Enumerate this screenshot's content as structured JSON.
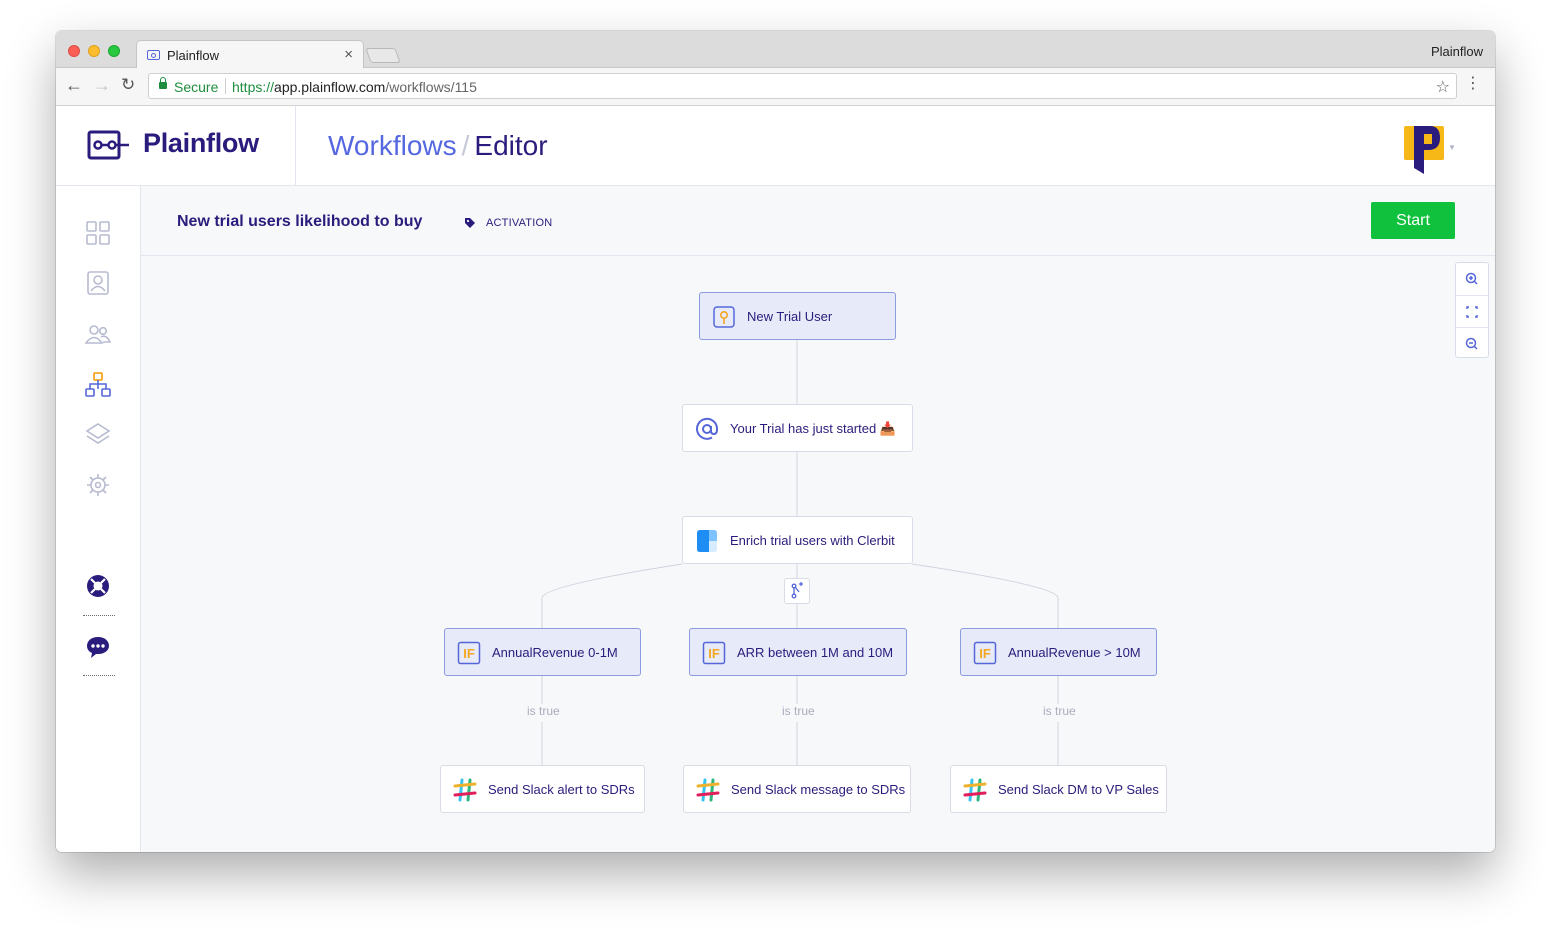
{
  "browser": {
    "tab_title": "Plainflow",
    "tab_close": "×",
    "profile_name": "Plainflow",
    "back": "←",
    "forward": "→",
    "reload": "↻",
    "secure_label": "Secure",
    "url_scheme": "https://",
    "url_host": "app.plainflow.com",
    "url_path": "/workflows/115",
    "star": "☆",
    "menu": "⋮"
  },
  "app": {
    "brand_name": "Plainflow",
    "breadcrumb": {
      "parent": "Workflows",
      "separator": "/",
      "current": "Editor"
    }
  },
  "sidebar": {
    "items": [
      {
        "name": "dashboard-icon"
      },
      {
        "name": "user-profile-icon"
      },
      {
        "name": "people-icon"
      },
      {
        "name": "workflows-icon",
        "active": true
      },
      {
        "name": "layers-icon"
      },
      {
        "name": "settings-gear-icon"
      },
      {
        "name": "help-lifebuoy-icon"
      },
      {
        "name": "chat-icon"
      }
    ]
  },
  "workflow": {
    "title": "New trial users likelihood to buy",
    "tag": "ACTIVATION",
    "start_label": "Start"
  },
  "colors": {
    "brand": "#2a1c7c",
    "link": "#5568e0",
    "start_button": "#0fc13c",
    "trigger_fill": "#e6eaf9",
    "trigger_border": "#8c9ae0",
    "if_icon": "#f5a623"
  },
  "nodes": {
    "trigger": {
      "label": "New Trial User",
      "icon": "key-icon"
    },
    "email": {
      "label": "Your Trial has just started 📥",
      "icon": "at-sign-icon"
    },
    "enrich": {
      "label": "Enrich trial users with Clerbit",
      "icon": "clearbit-icon"
    },
    "conditions": [
      {
        "label": "AnnualRevenue 0-1M",
        "icon": "if-icon",
        "icon_text": "IF"
      },
      {
        "label": "ARR between 1M and 10M",
        "icon": "if-icon",
        "icon_text": "IF"
      },
      {
        "label": "AnnualRevenue > 10M",
        "icon": "if-icon",
        "icon_text": "IF"
      }
    ],
    "edge_label": "is true",
    "actions": [
      {
        "label": "Send Slack alert to SDRs",
        "icon": "slack-icon"
      },
      {
        "label": "Send Slack message to SDRs",
        "icon": "slack-icon"
      },
      {
        "label": "Send Slack DM to VP Sales",
        "icon": "slack-icon"
      }
    ]
  },
  "zoom_controls": [
    {
      "name": "zoom-in-icon"
    },
    {
      "name": "fit-screen-icon"
    },
    {
      "name": "zoom-out-icon"
    }
  ]
}
